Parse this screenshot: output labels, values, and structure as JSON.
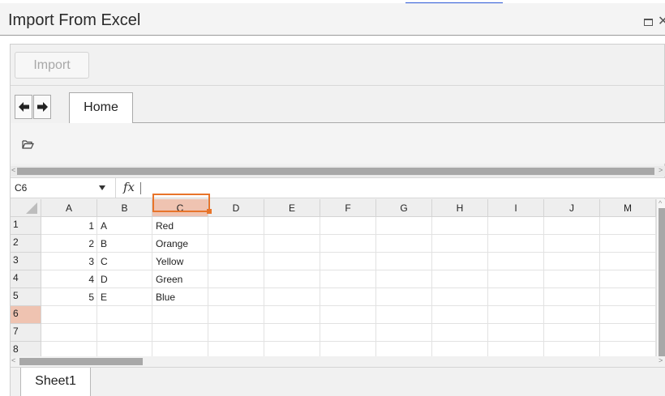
{
  "window": {
    "title": "Import From Excel"
  },
  "toolbar": {
    "import_label": "Import"
  },
  "ribbon": {
    "tabs": [
      {
        "label": "Home"
      }
    ]
  },
  "formula_bar": {
    "name_box_value": "C6",
    "fx_label": "fx"
  },
  "grid": {
    "columns": [
      "A",
      "B",
      "C",
      "D",
      "E",
      "F",
      "G",
      "H",
      "I",
      "J",
      "M"
    ],
    "rows": [
      "1",
      "2",
      "3",
      "4",
      "5",
      "6",
      "7",
      "8"
    ],
    "active_cell": "C6",
    "data": [
      [
        "1",
        "A",
        "Red"
      ],
      [
        "2",
        "B",
        "Orange"
      ],
      [
        "3",
        "C",
        "Yellow"
      ],
      [
        "4",
        "D",
        "Green"
      ],
      [
        "5",
        "E",
        "Blue"
      ]
    ]
  },
  "sheets": [
    {
      "label": "Sheet1"
    }
  ],
  "colors": {
    "selection": "#e8742a",
    "active_header": "#efc3b1"
  }
}
